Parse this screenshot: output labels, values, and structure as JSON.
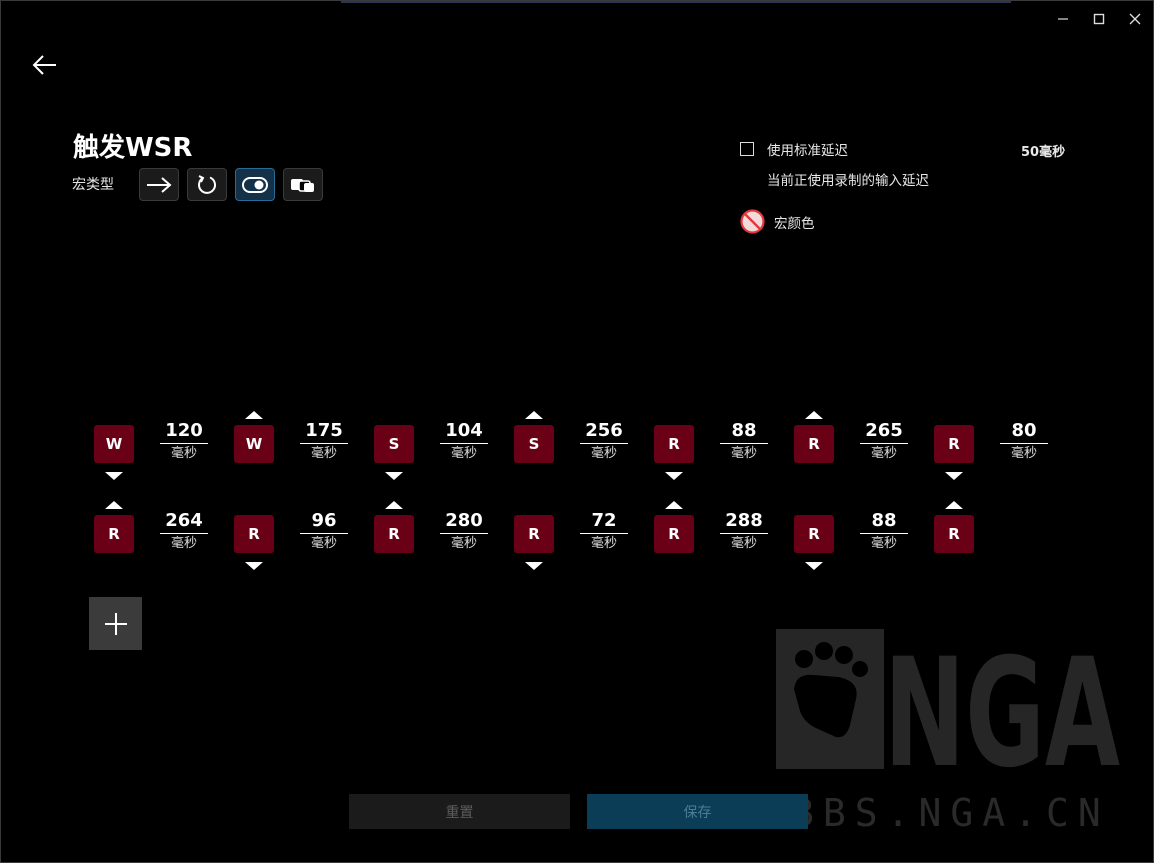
{
  "title": "触发WSR",
  "macro_type_label": "宏类型",
  "macro_types": [
    {
      "name": "no-repeat",
      "active": false
    },
    {
      "name": "repeat-while-held",
      "active": false
    },
    {
      "name": "toggle",
      "active": true
    },
    {
      "name": "sequence",
      "active": false
    }
  ],
  "settings": {
    "use_standard_delay_label": "使用标准延迟",
    "standard_delay_value": "50毫秒",
    "standard_delay_checked": false,
    "recorded_delay_note": "当前正使用录制的输入延迟",
    "macro_color_label": "宏颜色"
  },
  "delay_unit": "毫秒",
  "sequence_rows": [
    [
      {
        "key": "W",
        "dir": "down"
      },
      {
        "delay": "120"
      },
      {
        "key": "W",
        "dir": "up"
      },
      {
        "delay": "175"
      },
      {
        "key": "S",
        "dir": "down"
      },
      {
        "delay": "104"
      },
      {
        "key": "S",
        "dir": "up"
      },
      {
        "delay": "256"
      },
      {
        "key": "R",
        "dir": "down"
      },
      {
        "delay": "88"
      },
      {
        "key": "R",
        "dir": "up"
      },
      {
        "delay": "265"
      },
      {
        "key": "R",
        "dir": "down"
      },
      {
        "delay": "80"
      }
    ],
    [
      {
        "key": "R",
        "dir": "up"
      },
      {
        "delay": "264"
      },
      {
        "key": "R",
        "dir": "down"
      },
      {
        "delay": "96"
      },
      {
        "key": "R",
        "dir": "up"
      },
      {
        "delay": "280"
      },
      {
        "key": "R",
        "dir": "down"
      },
      {
        "delay": "72"
      },
      {
        "key": "R",
        "dir": "up"
      },
      {
        "delay": "288"
      },
      {
        "key": "R",
        "dir": "down"
      },
      {
        "delay": "88"
      },
      {
        "key": "R",
        "dir": "up"
      }
    ]
  ],
  "buttons": {
    "reset": "重置",
    "save": "保存"
  },
  "watermark_text": "BBS.NGA.CN",
  "watermark_logo": "NGA"
}
